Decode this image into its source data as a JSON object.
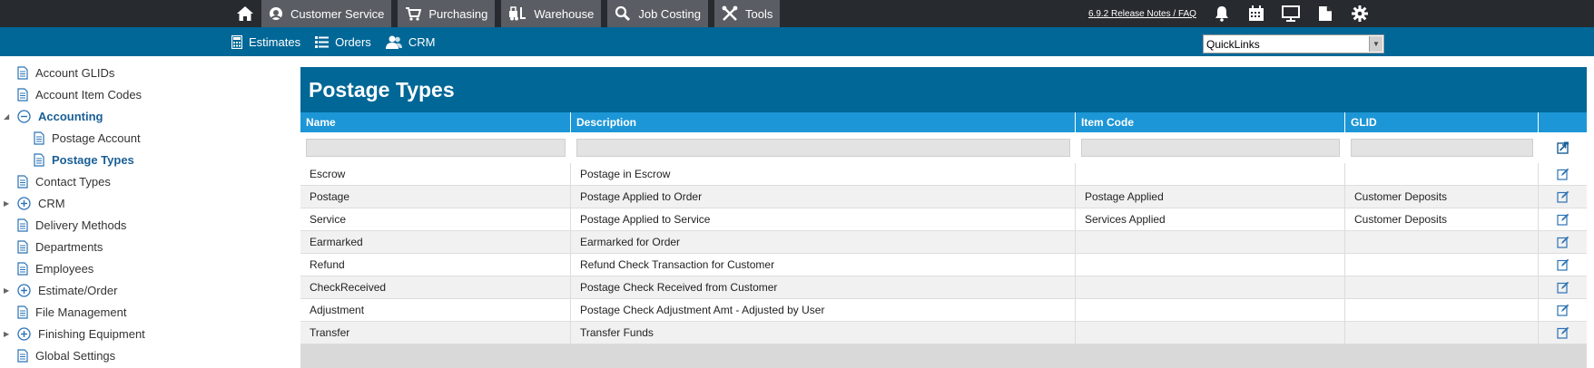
{
  "topnav": {
    "items": [
      {
        "label": "Customer Service",
        "icon": "customer-service-icon"
      },
      {
        "label": "Purchasing",
        "icon": "cart-icon"
      },
      {
        "label": "Warehouse",
        "icon": "forklift-icon"
      },
      {
        "label": "Job Costing",
        "icon": "magnifier-icon"
      },
      {
        "label": "Tools",
        "icon": "tools-icon"
      }
    ],
    "release_notes": "6.9.2 Release Notes / FAQ",
    "right_icons": [
      "bell-icon",
      "calendar-icon",
      "monitor-icon",
      "document-icon",
      "gear-icon"
    ]
  },
  "subnav": {
    "items": [
      {
        "label": "Estimates",
        "icon": "calculator-icon"
      },
      {
        "label": "Orders",
        "icon": "list-icon"
      },
      {
        "label": "CRM",
        "icon": "users-icon"
      }
    ],
    "quicklinks": "QuickLinks"
  },
  "sidebar": {
    "items": [
      {
        "label": "Account GLIDs",
        "type": "page"
      },
      {
        "label": "Account Item Codes",
        "type": "page"
      },
      {
        "label": "Accounting",
        "type": "expanded"
      },
      {
        "label": "Postage Account",
        "type": "child"
      },
      {
        "label": "Postage Types",
        "type": "child-active"
      },
      {
        "label": "Contact Types",
        "type": "page"
      },
      {
        "label": "CRM",
        "type": "collapsed"
      },
      {
        "label": "Delivery Methods",
        "type": "page"
      },
      {
        "label": "Departments",
        "type": "page"
      },
      {
        "label": "Employees",
        "type": "page"
      },
      {
        "label": "Estimate/Order",
        "type": "collapsed"
      },
      {
        "label": "File Management",
        "type": "page"
      },
      {
        "label": "Finishing Equipment",
        "type": "collapsed"
      },
      {
        "label": "Global Settings",
        "type": "page"
      }
    ]
  },
  "main": {
    "title": "Postage Types",
    "columns": [
      "Name",
      "Description",
      "Item Code",
      "GLID"
    ],
    "rows": [
      {
        "name": "Escrow",
        "description": "Postage in Escrow",
        "item_code": "",
        "glid": ""
      },
      {
        "name": "Postage",
        "description": "Postage Applied to Order",
        "item_code": "Postage Applied",
        "glid": "Customer Deposits"
      },
      {
        "name": "Service",
        "description": "Postage Applied to Service",
        "item_code": "Services Applied",
        "glid": "Customer Deposits"
      },
      {
        "name": "Earmarked",
        "description": "Earmarked for Order",
        "item_code": "",
        "glid": ""
      },
      {
        "name": "Refund",
        "description": "Refund Check Transaction for Customer",
        "item_code": "",
        "glid": ""
      },
      {
        "name": "CheckReceived",
        "description": "Postage Check Received from Customer",
        "item_code": "",
        "glid": ""
      },
      {
        "name": "Adjustment",
        "description": "Postage Check Adjustment Amt - Adjusted by User",
        "item_code": "",
        "glid": ""
      },
      {
        "name": "Transfer",
        "description": "Transfer Funds",
        "item_code": "",
        "glid": ""
      }
    ]
  },
  "colors": {
    "topbar": "#272a2e",
    "subbar": "#006797",
    "header": "#1c96d6",
    "accent": "#1a5f96"
  }
}
